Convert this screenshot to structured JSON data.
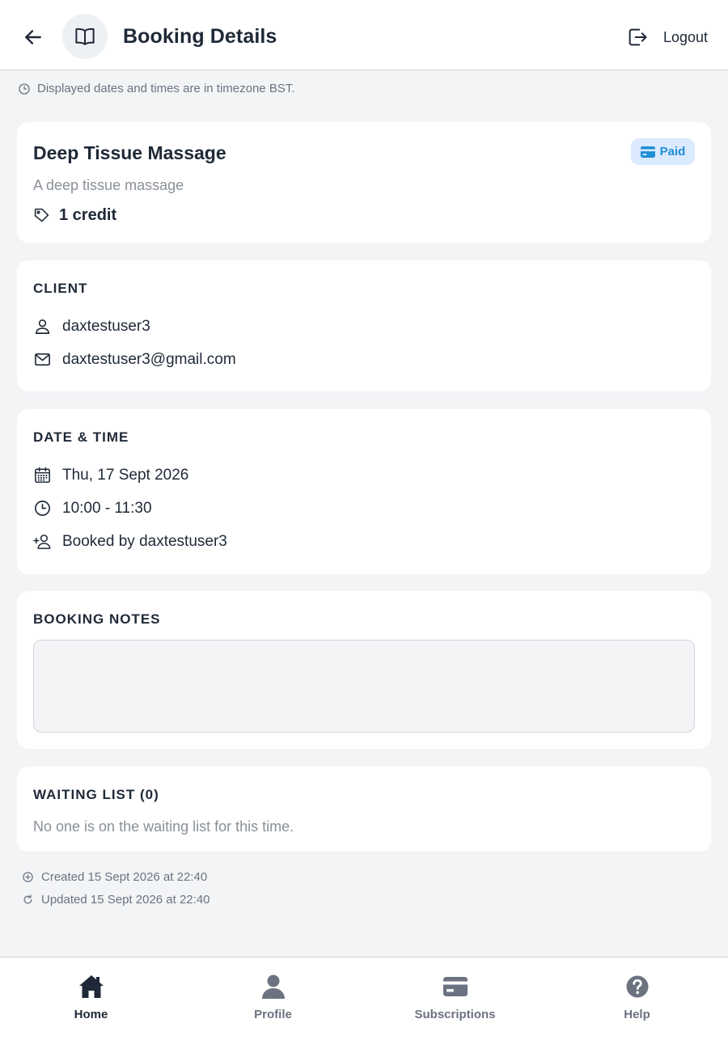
{
  "header": {
    "title": "Booking Details",
    "logout_label": "Logout"
  },
  "timezone_note": "Displayed dates and times are in timezone BST.",
  "service": {
    "name": "Deep Tissue Massage",
    "description": "A deep tissue massage",
    "credit": "1 credit",
    "payment_status": "Paid"
  },
  "client": {
    "section_title": "CLIENT",
    "username": "daxtestuser3",
    "email": "daxtestuser3@gmail.com"
  },
  "datetime": {
    "section_title": "DATE & TIME",
    "date": "Thu, 17 Sept 2026",
    "time": "10:00 - 11:30",
    "booked_by": "Booked by daxtestuser3"
  },
  "notes": {
    "section_title": "BOOKING NOTES",
    "value": ""
  },
  "waiting_list": {
    "section_title": "WAITING LIST (0)",
    "empty_text": "No one is on the waiting list for this time."
  },
  "meta": {
    "created": "Created 15 Sept 2026 at 22:40",
    "updated": "Updated 15 Sept 2026 at 22:40"
  },
  "nav": {
    "items": [
      {
        "label": "Home",
        "icon": "home-icon",
        "active": true
      },
      {
        "label": "Profile",
        "icon": "profile-icon",
        "active": false
      },
      {
        "label": "Subscriptions",
        "icon": "credit-card-icon",
        "active": false
      },
      {
        "label": "Help",
        "icon": "help-icon",
        "active": false
      }
    ]
  },
  "colors": {
    "accent_paid": "#1d8fd6",
    "paid_bg": "#dbeafe",
    "text_primary": "#1f2937",
    "text_muted": "#8a9099",
    "background": "#f3f4f6"
  }
}
